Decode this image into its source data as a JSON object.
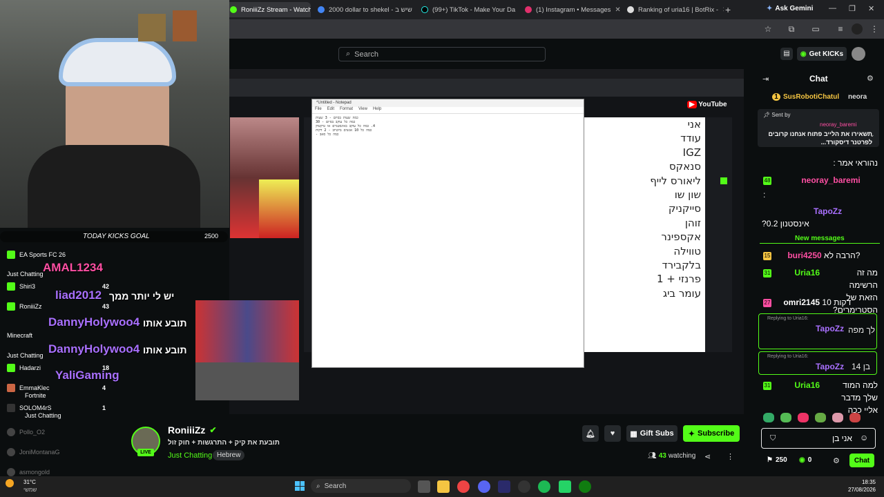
{
  "browser": {
    "tabs": [
      {
        "label": "RoniiiZz Stream - Watch",
        "active": true
      },
      {
        "label": "2000 dollar to shekel - שיש ב"
      },
      {
        "label": "(99+) TikTok - Make Your Da"
      },
      {
        "label": "(1) Instagram • Messages"
      },
      {
        "label": "Ranking of uria16 | BotRix -"
      }
    ],
    "ask_gemini": "Ask Gemini"
  },
  "kick_header": {
    "search_placeholder": "Search",
    "get_kicks": "Get KICKs"
  },
  "overlay": {
    "kicks_goal": "TODAY KICKS GOAL",
    "kicks_goal_value": "2500",
    "sidebar_users": [
      {
        "name": "EA Sports FC 26",
        "count": ""
      },
      {
        "name": "Just Chatting",
        "count": ""
      },
      {
        "name": "Shiri3",
        "count": "42"
      },
      {
        "name": "RoniiiZz",
        "count": "43"
      },
      {
        "name": "Minecraft",
        "count": ""
      },
      {
        "name": "Just Chatting",
        "count": ""
      },
      {
        "name": "Hadarzi",
        "count": "18"
      },
      {
        "name": "EmmaKlec",
        "count": "4"
      },
      {
        "name": "Fortnite",
        "count": ""
      },
      {
        "name": "SOLOM4rS",
        "count": "1"
      },
      {
        "name": "Just Chatting",
        "count": ""
      },
      {
        "name": "Pollo_O2",
        "count": ""
      },
      {
        "name": "JoniMontanaG",
        "count": ""
      },
      {
        "name": "asmongold",
        "count": ""
      }
    ],
    "big_chat": [
      {
        "user": "AMAL1234",
        "text": ""
      },
      {
        "user": "liad2012",
        "text": "יש לי יותר ממך"
      },
      {
        "user": "DannyHolywoo4",
        "text": "תובע אותו"
      },
      {
        "user": "DannyHolywoo4",
        "text": "תובע אותו"
      },
      {
        "user": "YaliGaming",
        "text": ""
      }
    ],
    "notepad": {
      "title": "*Untitled - Notepad",
      "menu": [
        "File",
        "Edit",
        "Format",
        "View",
        "Help"
      ],
      "lines": [
        "כמה שעות בסיום - 3 שעות",
        "כמה כל עוקב בסיום - 30",
        "4. כמה כל עוקב באינסטגרם או טיקטוק",
        "כמה כל 10 אנשים ביוטיוב - 2 דקות",
        "כמה כל סאב -"
      ]
    },
    "list": [
      "אני",
      "עודד",
      "IGZ",
      "סנאקס",
      "ליאורס לייף",
      "שון שו",
      "סייקניק",
      "זוהן",
      "אקספינר",
      "טווילה",
      "בלקבירד",
      "פרנזי + 1",
      "עומר ביג"
    ]
  },
  "stream_info": {
    "streamer": "RoniiiZz",
    "title": "תובעת את קיק + התרגשות + חוק זול",
    "category": "Just Chatting",
    "tag": "Hebrew",
    "live": "LIVE",
    "gift_subs": "Gift Subs",
    "subscribe": "Subscribe",
    "viewers": "43",
    "viewers_label": "watching"
  },
  "chat": {
    "title": "Chat",
    "top_gifters": [
      "SusRobotiChatul",
      "1",
      "neora"
    ],
    "pinned_by": "Sent by",
    "pinned_user": "neoray_baremi",
    "pinned_text": "תשאירו את הלייב פתוח אנחנו קרובים לפרטנר דיסקורד...",
    "messages": [
      {
        "user": "neoray_baremi",
        "text": "נהוראי אמר :",
        "color": "#ff4fa3"
      },
      {
        "user": "neoray_baremi",
        "text": ":",
        "color": "#ff4fa3",
        "badge": "48"
      },
      {
        "user": "TapoZz",
        "text": "אינסטנון 0.2?",
        "color": "#a970ff"
      },
      {
        "user": "buri4250",
        "text": "הרבה לא?",
        "color": "#ff4fa3",
        "badge": "15"
      },
      {
        "user": "Uria16",
        "text": "מה זה הרשימה הזאת של הסטרימרים?",
        "color": "#53fc18",
        "badge": "31"
      },
      {
        "user": "omri2145",
        "text": "10 דקות",
        "color": "#fff",
        "badge": "27"
      },
      {
        "user": "TapoZz",
        "text": "לך מפה",
        "color": "#a970ff",
        "reply": "Replying to Uria16:"
      },
      {
        "user": "TapoZz",
        "text": "בן 14",
        "color": "#a970ff",
        "reply": "Replying to Uria16:"
      },
      {
        "user": "Uria16",
        "text": "למה המוד שלך מדבר אליי ככה",
        "color": "#53fc18",
        "badge": "31"
      }
    ],
    "new_messages": "New messages",
    "input_value": "אני בן",
    "points": "250",
    "kicks": "0",
    "send": "Chat"
  },
  "taskbar": {
    "weather_temp": "31°C",
    "weather_desc": "שמשי",
    "search": "Search",
    "time": "18:35",
    "date": "27/08/2026"
  }
}
